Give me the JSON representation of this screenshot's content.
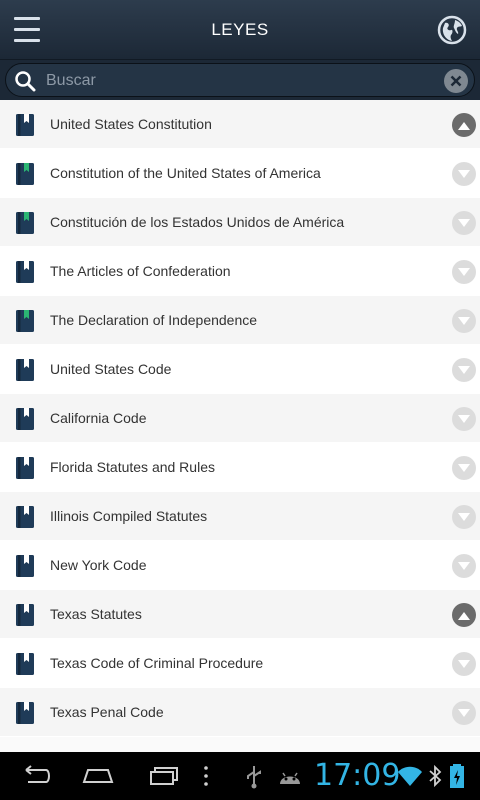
{
  "header": {
    "title": "LEYES"
  },
  "search": {
    "placeholder": "Buscar",
    "value": ""
  },
  "list": {
    "items": [
      {
        "label": "United States Constitution",
        "bookmark_color": "#ffffff",
        "expanded": true
      },
      {
        "label": "Constitution of the United States of America",
        "bookmark_color": "#2bb673",
        "expanded": false
      },
      {
        "label": "Constitución de los Estados Unidos de América",
        "bookmark_color": "#2bb673",
        "expanded": false
      },
      {
        "label": "The Articles of Confederation",
        "bookmark_color": "#ffffff",
        "expanded": false
      },
      {
        "label": "The Declaration of Independence",
        "bookmark_color": "#2bb673",
        "expanded": false
      },
      {
        "label": "United States Code",
        "bookmark_color": "#ffffff",
        "expanded": false
      },
      {
        "label": "California Code",
        "bookmark_color": "#ffffff",
        "expanded": false
      },
      {
        "label": "Florida Statutes and Rules",
        "bookmark_color": "#ffffff",
        "expanded": false
      },
      {
        "label": "Illinois Compiled Statutes",
        "bookmark_color": "#ffffff",
        "expanded": false
      },
      {
        "label": "New York Code",
        "bookmark_color": "#ffffff",
        "expanded": false
      },
      {
        "label": "Texas Statutes",
        "bookmark_color": "#ffffff",
        "expanded": true
      },
      {
        "label": "Texas Code of Criminal Procedure",
        "bookmark_color": "#ffffff",
        "expanded": false
      },
      {
        "label": "Texas Penal Code",
        "bookmark_color": "#ffffff",
        "expanded": false
      }
    ]
  },
  "status_bar": {
    "time": "17:09"
  },
  "colors": {
    "header": "#1c2836",
    "book": "#1f3b58",
    "accent": "#33b5e5"
  },
  "icons": {
    "menu": "menu-icon",
    "globe": "globe-icon",
    "search": "search-icon",
    "clear": "clear-icon",
    "book": "book-icon"
  }
}
